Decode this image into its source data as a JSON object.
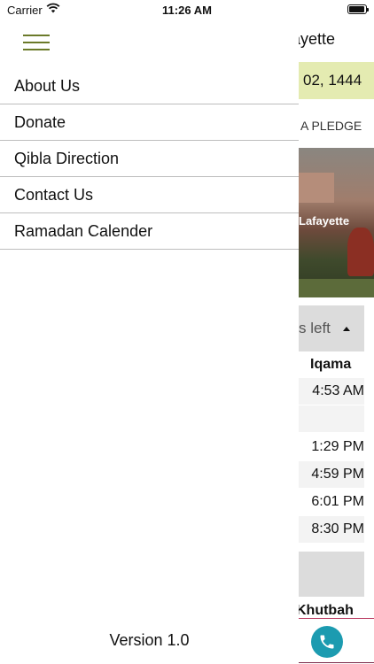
{
  "status_bar": {
    "carrier": "Carrier",
    "time": "11:26 AM"
  },
  "drawer": {
    "menu_items": [
      {
        "label": "About Us"
      },
      {
        "label": "Donate"
      },
      {
        "label": "Qibla Direction"
      },
      {
        "label": "Contact Us"
      },
      {
        "label": "Ramadan Calender"
      }
    ],
    "version": "Version 1.0",
    "accent_color": "#6b7a2a"
  },
  "background_screen": {
    "header_fragment": "ayette",
    "hijri_date_fragment": "02, 1444",
    "pledge_fragment": "A PLEDGE",
    "photo_caption_fragment": "Lafayette",
    "countdown_fragment": "s  left",
    "iqama_header": "Iqama",
    "iqama_times": [
      "4:53 AM",
      "",
      "1:29 PM",
      "4:59 PM",
      "6:01 PM",
      "8:30 PM"
    ],
    "khutbah_fragment": "Khutbah",
    "call_icon": "phone-icon",
    "date_band_color": "#e4ebb1",
    "call_button_color": "#1c9bb0"
  }
}
